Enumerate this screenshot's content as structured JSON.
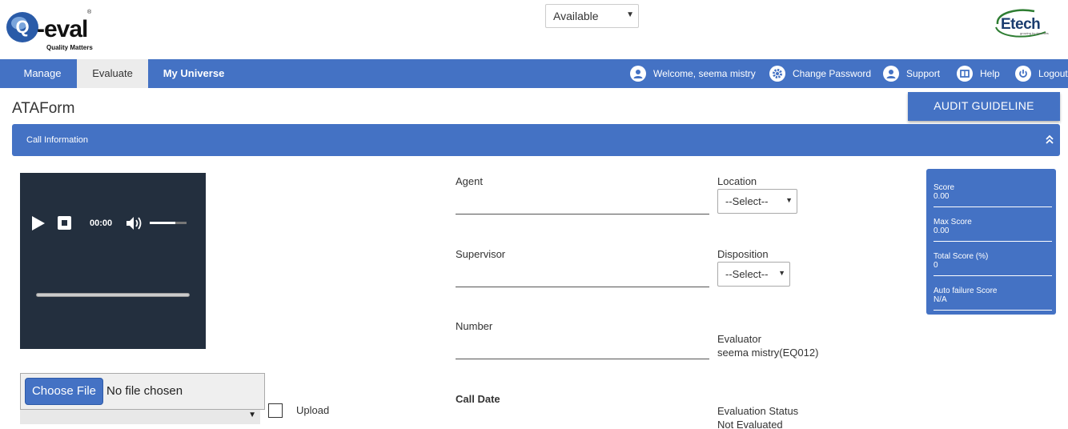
{
  "header": {
    "logo_text": "Q-eval",
    "logo_tagline": "Quality Matters",
    "status_select": "Available",
    "brand_text": "Etech"
  },
  "nav": {
    "tabs": [
      {
        "label": "Manage"
      },
      {
        "label": "Evaluate",
        "active": true
      },
      {
        "label": "My Universe"
      }
    ],
    "welcome": "Welcome, seema mistry",
    "change_password": "Change Password",
    "support": "Support",
    "help": "Help",
    "logout": "Logout"
  },
  "page": {
    "title": "ATAForm",
    "audit_button": "AUDIT GUIDELINE",
    "panel_title": "Call Information"
  },
  "player": {
    "time": "00:00",
    "volume_level": 0.7
  },
  "file": {
    "choose_label": "Choose File",
    "status": "No file chosen",
    "upload_label": "Upload"
  },
  "fields": {
    "agent_label": "Agent",
    "supervisor_label": "Supervisor",
    "number_label": "Number",
    "call_date_label": "Call Date",
    "location_label": "Location",
    "location_value": "--Select--",
    "disposition_label": "Disposition",
    "disposition_value": "--Select--",
    "evaluator_label": "Evaluator",
    "evaluator_value": "seema mistry(EQ012)",
    "eval_status_label": "Evaluation Status",
    "eval_status_value": "Not Evaluated"
  },
  "scores": [
    {
      "label": "Score",
      "value": "0.00"
    },
    {
      "label": "Max Score",
      "value": "0.00"
    },
    {
      "label": "Total Score (%)",
      "value": "0"
    },
    {
      "label": "Auto failure Score",
      "value": "N/A"
    }
  ],
  "colors": {
    "primary": "#4472c4",
    "player_bg": "#232f3e"
  }
}
